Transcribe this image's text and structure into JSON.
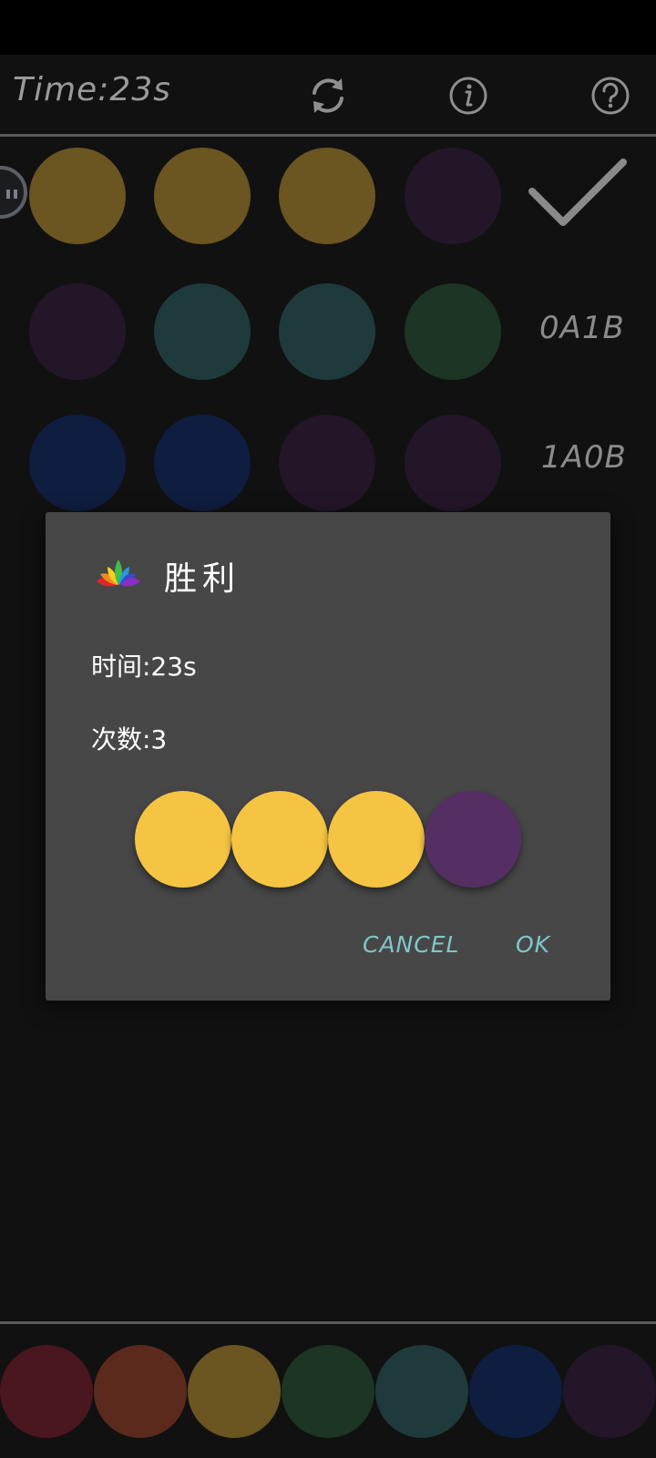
{
  "header": {
    "timer_text": "Time:23s",
    "refresh_icon": "refresh-icon",
    "info_icon": "info-icon",
    "help_icon": "help-icon"
  },
  "board": {
    "rows": [
      {
        "colors": [
          "#6b5520",
          "#6b5520",
          "#6b5520",
          "#231629"
        ],
        "status": "check"
      },
      {
        "colors": [
          "#231629",
          "#1f3a3a",
          "#1f3a3a",
          "#1c3524"
        ],
        "status": "0A1B"
      },
      {
        "colors": [
          "#0f1d40",
          "#0f1d40",
          "#231629",
          "#231629"
        ],
        "status": "1A0B"
      }
    ]
  },
  "palette": {
    "colors": [
      "#4a1620",
      "#5c2a1c",
      "#6b5520",
      "#1c3524",
      "#1f3a3a",
      "#0f1d40",
      "#231629"
    ]
  },
  "dialog": {
    "title": "胜利",
    "time_text": "时间:23s",
    "count_text": "次数:3",
    "answer_colors": [
      "#f5c443",
      "#f5c443",
      "#f5c443",
      "#552f63"
    ],
    "cancel_label": "CANCEL",
    "ok_label": "OK"
  }
}
